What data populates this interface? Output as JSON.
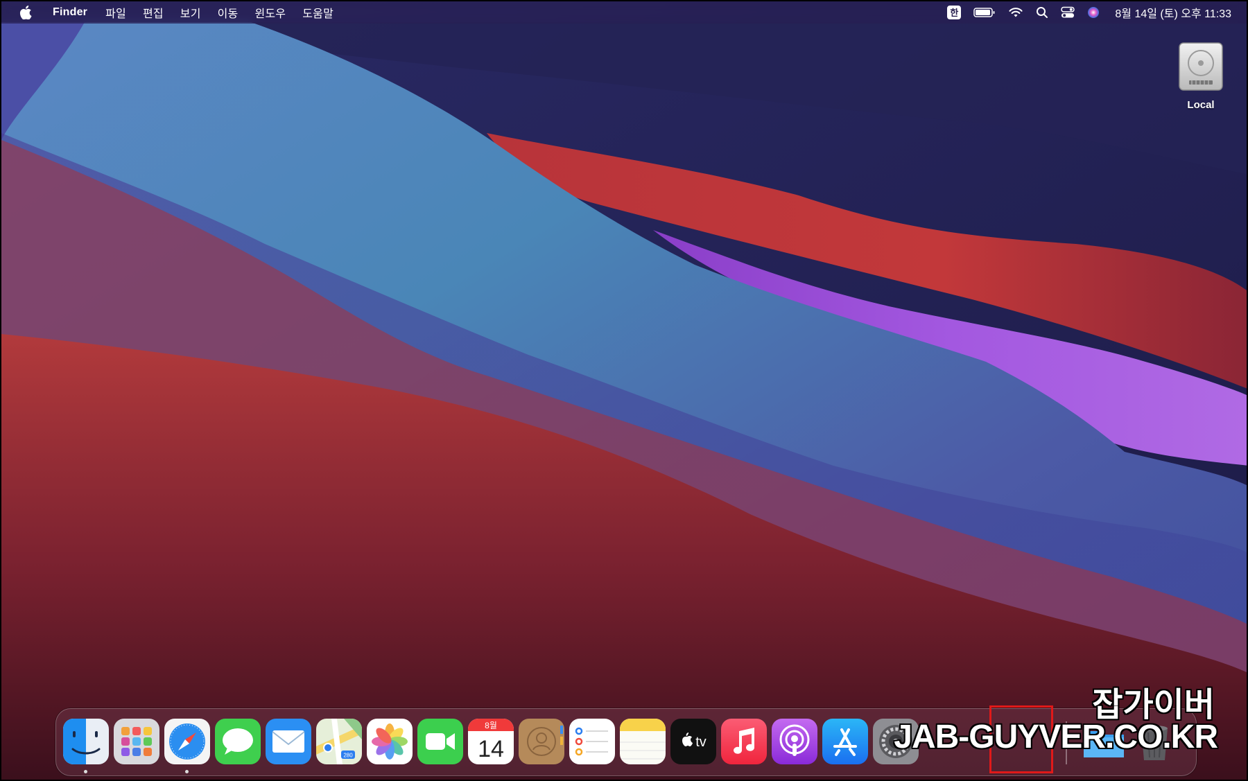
{
  "menubar": {
    "app_name": "Finder",
    "menus": [
      "파일",
      "편집",
      "보기",
      "이동",
      "윈도우",
      "도움말"
    ],
    "ime": "한",
    "clock": "8월 14일 (토) 오후 11:33"
  },
  "desktop": {
    "drive_label": "Local"
  },
  "dock": {
    "apps": [
      {
        "name": "finder",
        "running": true
      },
      {
        "name": "launchpad",
        "running": false
      },
      {
        "name": "safari",
        "running": true
      },
      {
        "name": "messages",
        "running": false
      },
      {
        "name": "mail",
        "running": false
      },
      {
        "name": "maps",
        "running": false
      },
      {
        "name": "photos",
        "running": false
      },
      {
        "name": "facetime",
        "running": false
      },
      {
        "name": "calendar",
        "running": false
      },
      {
        "name": "contacts",
        "running": false
      },
      {
        "name": "reminders",
        "running": false
      },
      {
        "name": "notes",
        "running": false
      },
      {
        "name": "tv",
        "running": false
      },
      {
        "name": "music",
        "running": false
      },
      {
        "name": "podcasts",
        "running": false
      },
      {
        "name": "app-store",
        "running": false
      },
      {
        "name": "system-preferences",
        "running": false
      }
    ],
    "calendar_month": "8월",
    "calendar_day": "14",
    "tv_label": "tv",
    "maps_badge": "280"
  },
  "watermark": {
    "line1": "잡가이버",
    "line2": "JAB-GUYVER.CO.KR"
  },
  "colors": {
    "highlight": "#e01919",
    "sky": "#1f1d4a"
  }
}
